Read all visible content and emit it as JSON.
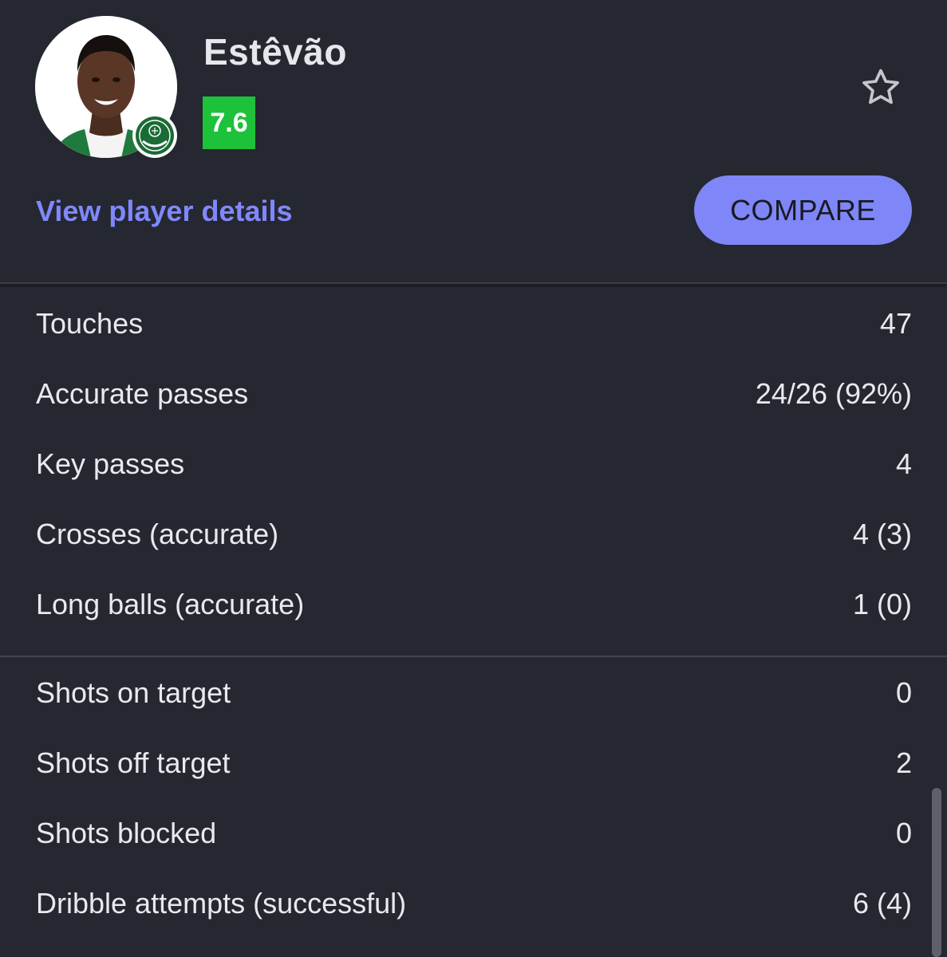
{
  "player": {
    "name": "Estêvão",
    "rating": "7.6",
    "rating_color": "#1ec13a",
    "club_badge_text": "PALMEIRAS"
  },
  "actions": {
    "details_link": "View player details",
    "compare_label": "COMPARE",
    "favorite_icon": "star-outline-icon"
  },
  "stats_groups": [
    {
      "rows": [
        {
          "label": "Touches",
          "value": "47"
        },
        {
          "label": "Accurate passes",
          "value": "24/26 (92%)"
        },
        {
          "label": "Key passes",
          "value": "4"
        },
        {
          "label": "Crosses (accurate)",
          "value": "4 (3)"
        },
        {
          "label": "Long balls (accurate)",
          "value": "1 (0)"
        }
      ]
    },
    {
      "rows": [
        {
          "label": "Shots on target",
          "value": "0"
        },
        {
          "label": "Shots off target",
          "value": "2"
        },
        {
          "label": "Shots blocked",
          "value": "0"
        },
        {
          "label": "Dribble attempts (successful)",
          "value": "6 (4)"
        }
      ]
    }
  ],
  "colors": {
    "background": "#252830",
    "accent": "#7f86f7",
    "link": "#8088ff"
  }
}
